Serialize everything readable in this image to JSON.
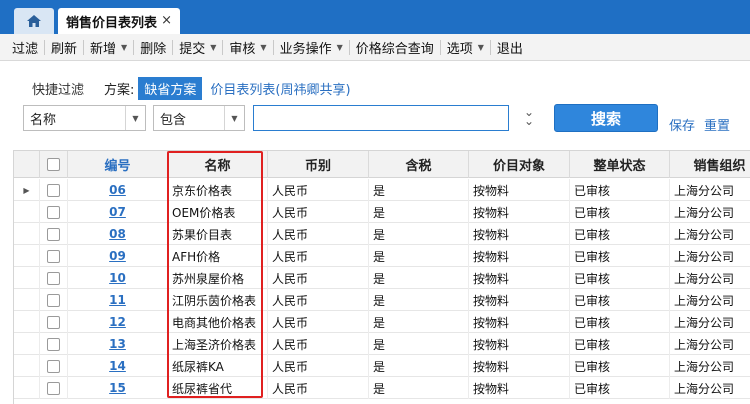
{
  "tabs": {
    "active_title": "销售价目表列表",
    "close_symbol": "×"
  },
  "toolbar": {
    "items": [
      {
        "label": "过滤",
        "dropdown": false
      },
      {
        "label": "刷新",
        "dropdown": false
      },
      {
        "label": "新增",
        "dropdown": true
      },
      {
        "label": "删除",
        "dropdown": false
      },
      {
        "label": "提交",
        "dropdown": true
      },
      {
        "label": "审核",
        "dropdown": true
      },
      {
        "label": "业务操作",
        "dropdown": true
      },
      {
        "label": "价格综合查询",
        "dropdown": false
      },
      {
        "label": "选项",
        "dropdown": true
      },
      {
        "label": "退出",
        "dropdown": false
      }
    ]
  },
  "quick_filter": {
    "label": "快捷过滤",
    "scheme_label": "方案:",
    "default_scheme": "缺省方案",
    "shared_scheme": "价目表列表(周祎卿共享)"
  },
  "filter": {
    "field": "名称",
    "operator": "包含",
    "value": "",
    "search_label": "搜索",
    "save_label": "保存",
    "reset_label": "重置"
  },
  "grid": {
    "columns": [
      "编号",
      "名称",
      "币别",
      "含税",
      "价目对象",
      "整单状态",
      "销售组织"
    ],
    "rows": [
      [
        "06",
        "京东价格表",
        "人民币",
        "是",
        "按物料",
        "已审核",
        "上海分公司"
      ],
      [
        "07",
        "OEM价格表",
        "人民币",
        "是",
        "按物料",
        "已审核",
        "上海分公司"
      ],
      [
        "08",
        "苏果价目表",
        "人民币",
        "是",
        "按物料",
        "已审核",
        "上海分公司"
      ],
      [
        "09",
        "AFH价格",
        "人民币",
        "是",
        "按物料",
        "已审核",
        "上海分公司"
      ],
      [
        "10",
        "苏州泉屋价格",
        "人民币",
        "是",
        "按物料",
        "已审核",
        "上海分公司"
      ],
      [
        "11",
        "江阴乐茵价格表",
        "人民币",
        "是",
        "按物料",
        "已审核",
        "上海分公司"
      ],
      [
        "12",
        "电商其他价格表",
        "人民币",
        "是",
        "按物料",
        "已审核",
        "上海分公司"
      ],
      [
        "13",
        "上海圣济价格表",
        "人民币",
        "是",
        "按物料",
        "已审核",
        "上海分公司"
      ],
      [
        "14",
        "纸尿裤KA",
        "人民币",
        "是",
        "按物料",
        "已审核",
        "上海分公司"
      ],
      [
        "15",
        "纸尿裤省代",
        "人民币",
        "是",
        "按物料",
        "已审核",
        "上海分公司"
      ]
    ]
  },
  "colors": {
    "tab_bar": "#1f6fc4",
    "accent": "#2a7dd0",
    "link": "#2a6fc1",
    "highlight": "#e02020"
  }
}
